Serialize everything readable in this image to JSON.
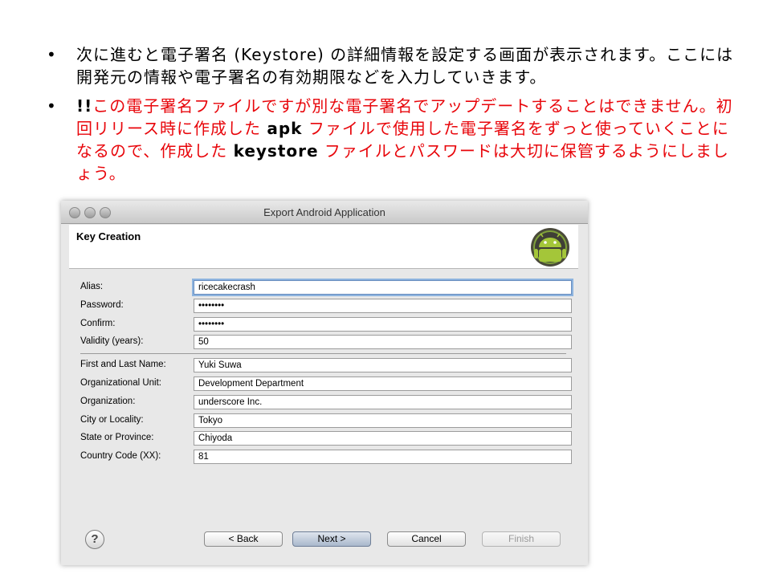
{
  "slide": {
    "bullet1": {
      "marker": "•",
      "text": "次に進むと電子署名 (Keystore) の詳細情報を設定する画面が表示されます。ここには開発元の情報や電子署名の有効期限などを入力していきます。"
    },
    "bullet2": {
      "marker": "•",
      "prefix": "!!",
      "part1": "この電子署名ファイルですが別な電子署名でアップデートすることはできません。初回リリース時に作成した ",
      "apk": "apk",
      "part2": " ファイルで使用した電子署名をずっと使っていくことになるので、作成した ",
      "keystore": "keystore",
      "part3": " ファイルとパスワードは大切に保管するようにしましょう。"
    }
  },
  "dialog": {
    "title": "Export Android Application",
    "header_title": "Key Creation",
    "fields": {
      "alias": {
        "label": "Alias:",
        "value": "ricecakecrash"
      },
      "password": {
        "label": "Password:",
        "value": "••••••••"
      },
      "confirm": {
        "label": "Confirm:",
        "value": "••••••••"
      },
      "validity": {
        "label": "Validity (years):",
        "value": "50"
      },
      "name": {
        "label": "First and Last Name:",
        "value": "Yuki Suwa"
      },
      "unit": {
        "label": "Organizational Unit:",
        "value": "Development Department"
      },
      "org": {
        "label": "Organization:",
        "value": "underscore Inc."
      },
      "city": {
        "label": "City or Locality:",
        "value": "Tokyo"
      },
      "state": {
        "label": "State or Province:",
        "value": "Chiyoda"
      },
      "country": {
        "label": "Country Code (XX):",
        "value": "81"
      }
    },
    "buttons": {
      "help": "?",
      "back": "< Back",
      "next": "Next >",
      "cancel": "Cancel",
      "finish": "Finish"
    },
    "icons": [
      "android-icon",
      "help-icon",
      "close-icon",
      "minimize-icon",
      "zoom-icon"
    ]
  }
}
